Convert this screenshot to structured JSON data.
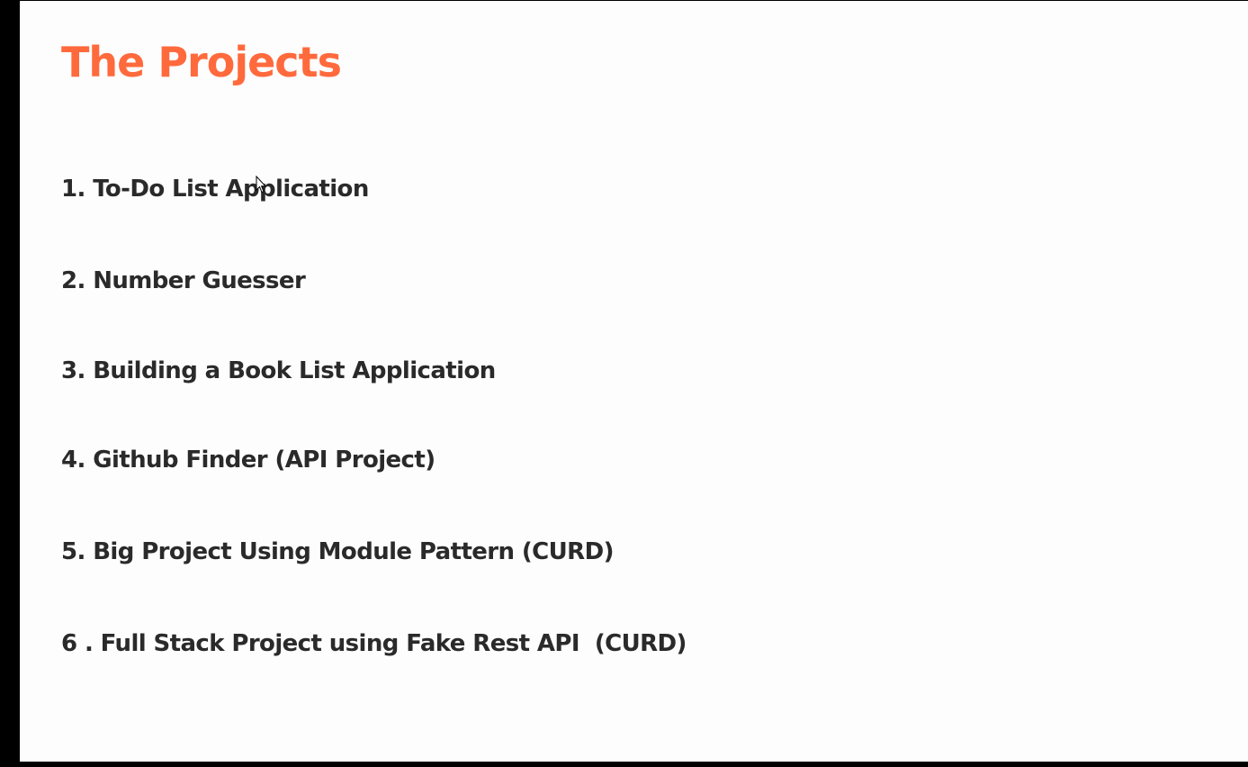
{
  "slide": {
    "title": "The Projects",
    "title_color": "#ff6a3d",
    "text_color": "#2a2a2a",
    "projects": [
      "1. To-Do List Application",
      "2. Number Guesser",
      "3. Building a Book List Application",
      "4. Github Finder (API Project)",
      "5. Big Project Using Module Pattern (CURD)",
      "6 . Full Stack Project using Fake Rest API  (CURD)"
    ]
  },
  "cursor": {
    "icon": "mouse-pointer-icon"
  }
}
